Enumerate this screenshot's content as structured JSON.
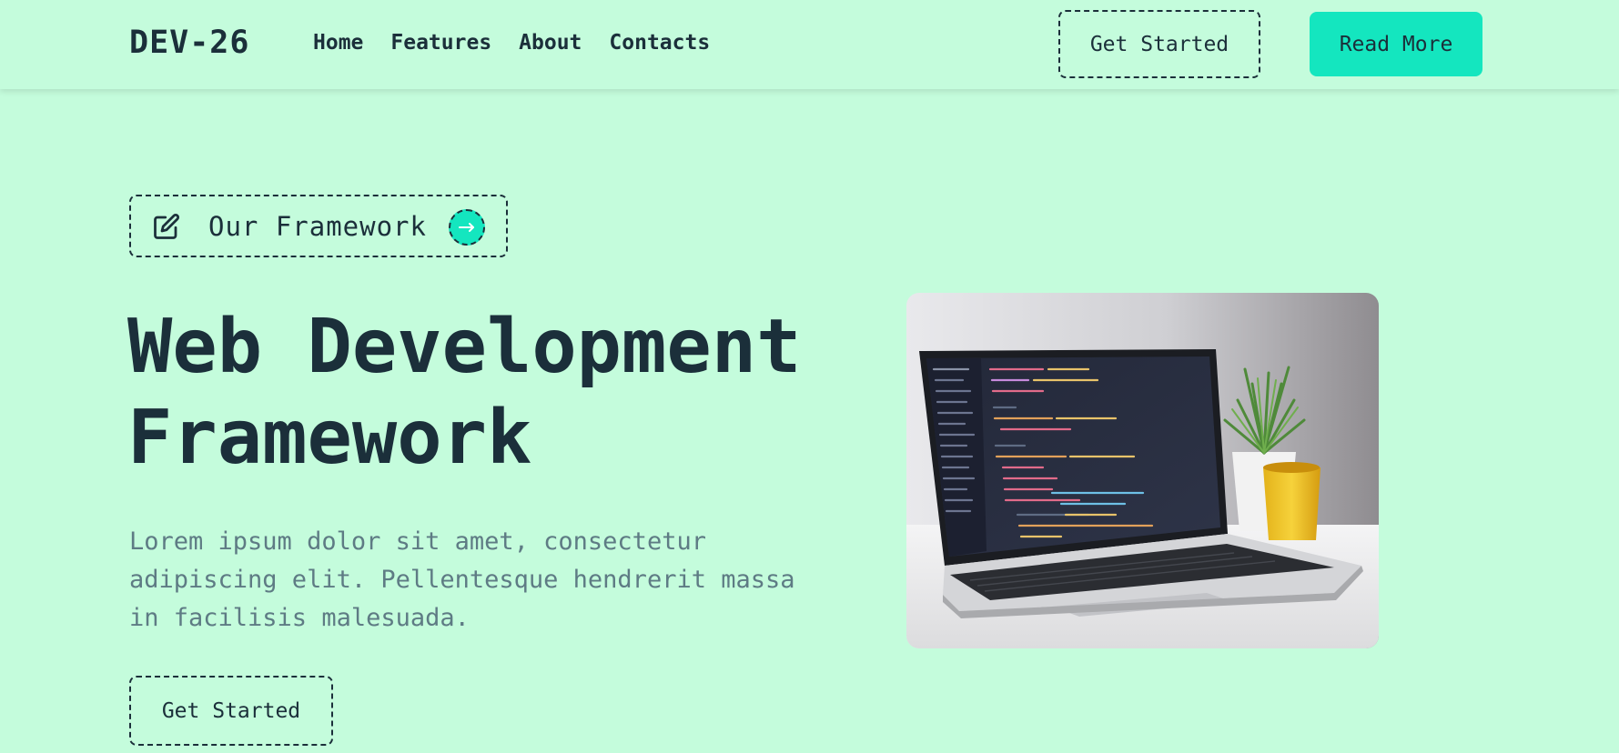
{
  "brand": {
    "logo": "DEV-26"
  },
  "nav": {
    "links": [
      "Home",
      "Features",
      "About",
      "Contacts"
    ],
    "get_started_label": "Get Started",
    "read_more_label": "Read More"
  },
  "hero": {
    "badge_label": "Our Framework",
    "title_line1": "Web Development",
    "title_line2": "Framework",
    "description": "Lorem ipsum dolor sit amet, consectetur adipiscing elit. Pellentesque hendrerit massa in facilisis malesuada.",
    "cta_label": "Get Started",
    "image_icon": "laptop-photo"
  },
  "icons": {
    "badge_icon": "edit-icon",
    "badge_arrow": "arrow-right-icon"
  },
  "colors": {
    "background": "#c4fcdc",
    "accent": "#14e6bf",
    "text_dark": "#1b2f3a",
    "text_muted": "#5e7b84"
  }
}
